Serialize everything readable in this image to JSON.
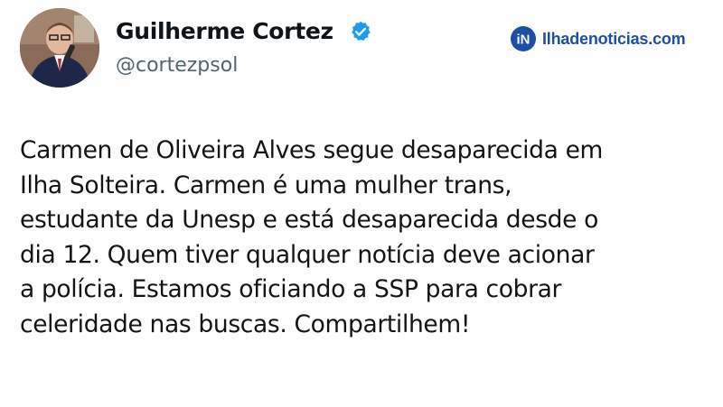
{
  "author": {
    "display_name": "Guilherme Cortez",
    "handle": "@cortezpsol",
    "verified_icon": "verified-badge-icon",
    "avatar_icon": "profile-photo"
  },
  "watermark": {
    "logo_letters": "iN",
    "text": "Ilhadenoticias.com",
    "color": "#1e4fa3"
  },
  "tweet": {
    "lines": [
      "Carmen de Oliveira Alves segue desaparecida em",
      "Ilha Solteira. Carmen é uma mulher trans,",
      "estudante da Unesp e está desaparecida desde o",
      "dia 12. Quem tiver qualquer notícia deve acionar",
      "a polícia. Estamos oficiando a SSP para cobrar",
      "celeridade nas buscas. Compartilhem!"
    ]
  },
  "colors": {
    "text": "#0f1419",
    "handle": "#536471",
    "verified": "#1d9bf0"
  }
}
